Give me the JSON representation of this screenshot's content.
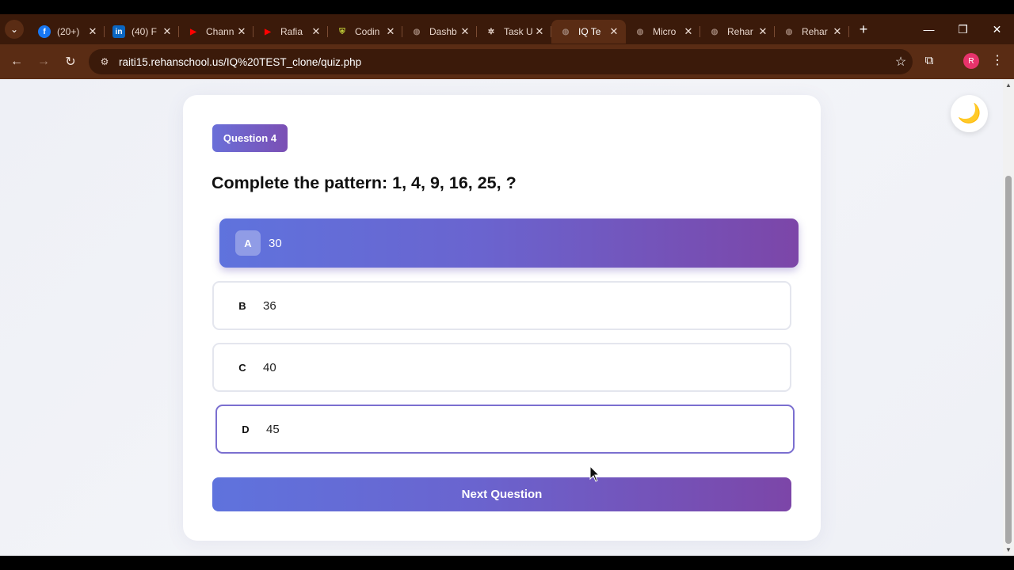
{
  "browser": {
    "tabs": [
      {
        "label": "(20+)",
        "icon": "facebook-icon",
        "color": "#1877f2",
        "glyph": "f"
      },
      {
        "label": "(40) F",
        "icon": "linkedin-icon",
        "color": "#0a66c2",
        "glyph": "in"
      },
      {
        "label": "Chann",
        "icon": "youtube-icon",
        "color": "#ff0000",
        "glyph": "▶"
      },
      {
        "label": "Rafia",
        "icon": "youtube-icon",
        "color": "#ff0000",
        "glyph": "▶"
      },
      {
        "label": "Codin",
        "icon": "shield-icon",
        "color": "#c6d63a",
        "glyph": "⛨"
      },
      {
        "label": "Dashb",
        "icon": "globe-icon",
        "color": "#9a7e70",
        "glyph": "◍"
      },
      {
        "label": "Task U",
        "icon": "openai-icon",
        "color": "#e8d6cc",
        "glyph": "✲"
      },
      {
        "label": "IQ Te",
        "icon": "globe-icon",
        "color": "#9a7e70",
        "glyph": "◍",
        "active": true
      },
      {
        "label": "Micro",
        "icon": "globe-icon",
        "color": "#9a7e70",
        "glyph": "◍"
      },
      {
        "label": "Rehar",
        "icon": "globe-icon",
        "color": "#9a7e70",
        "glyph": "◍"
      },
      {
        "label": "Rehar",
        "icon": "globe-icon",
        "color": "#9a7e70",
        "glyph": "◍"
      }
    ],
    "url": "raiti15.rehanschool.us/IQ%20TEST_clone/quiz.php",
    "profile_initial": "R"
  },
  "quiz": {
    "badge": "Question 4",
    "question": "Complete the pattern: 1, 4, 9, 16, 25, ?",
    "options": [
      {
        "letter": "A",
        "value": "30",
        "state": "selected"
      },
      {
        "letter": "B",
        "value": "36",
        "state": "default"
      },
      {
        "letter": "C",
        "value": "40",
        "state": "default"
      },
      {
        "letter": "D",
        "value": "45",
        "state": "hover"
      }
    ],
    "next_label": "Next Question"
  },
  "theme_toggle": {
    "icon": "moon-icon",
    "glyph": "🌙"
  },
  "colors": {
    "accent_start": "#5f73dd",
    "accent_end": "#7c46a8",
    "browser_frame": "#5a2c14"
  }
}
